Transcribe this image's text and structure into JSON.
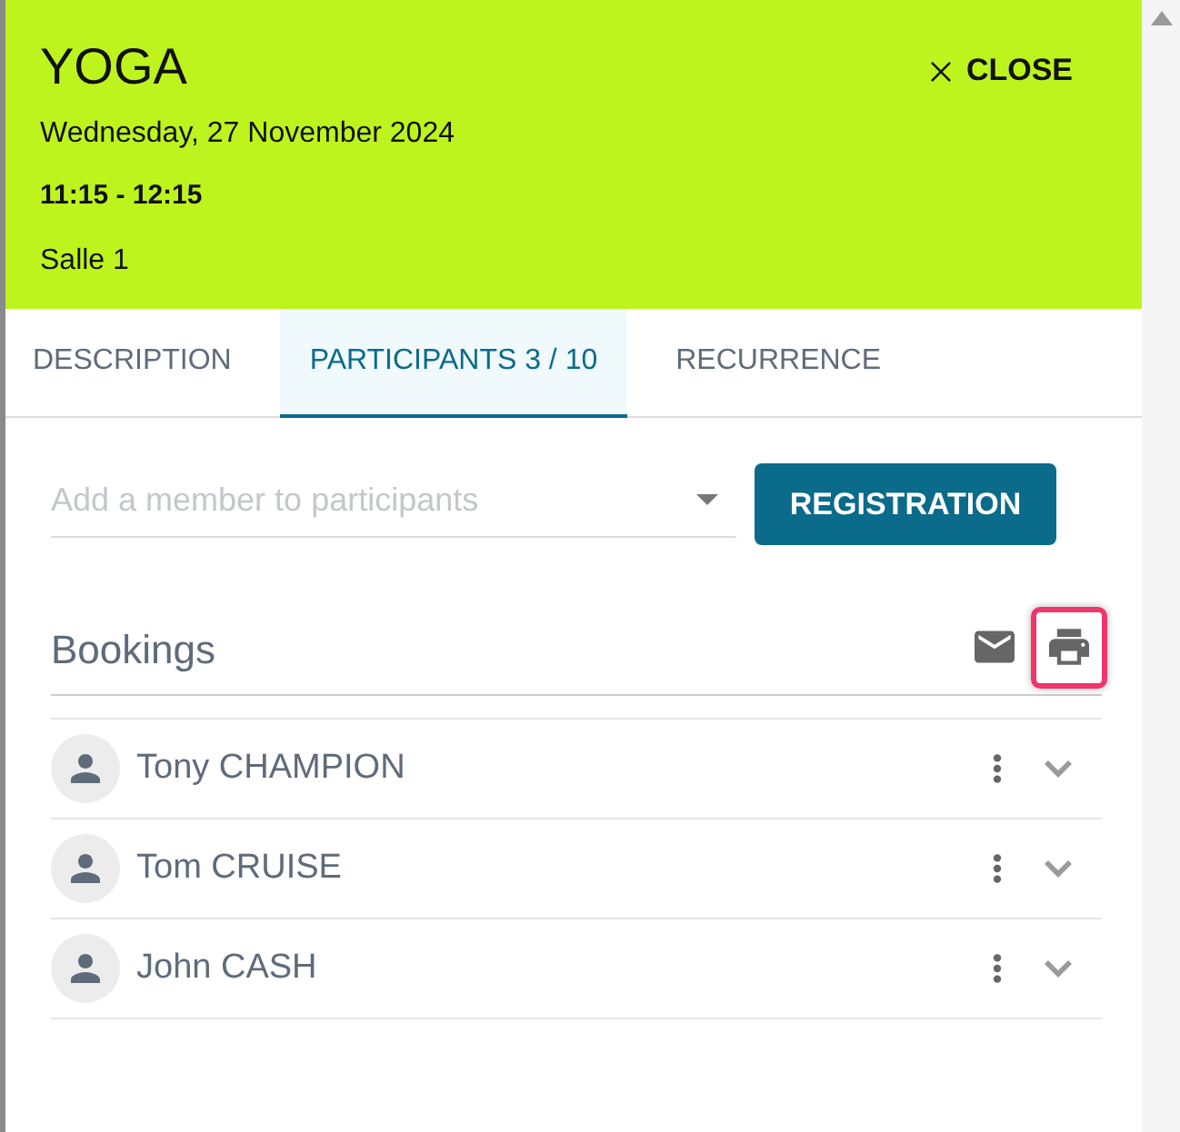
{
  "event": {
    "title": "YOGA",
    "date": "Wednesday, 27 November 2024",
    "time": "11:15 - 12:15",
    "room": "Salle 1"
  },
  "close_button": {
    "label": "CLOSE"
  },
  "tabs": [
    {
      "label": "DESCRIPTION",
      "selected": false
    },
    {
      "label": "PARTICIPANTS 3 / 10",
      "selected": true
    },
    {
      "label": "RECURRENCE",
      "selected": false
    }
  ],
  "member_field": {
    "placeholder": "Add a member to participants"
  },
  "registration_button": {
    "label": "REGISTRATION"
  },
  "bookings": {
    "title": "Bookings",
    "actions": [
      {
        "kind": "mail",
        "highlighted": false
      },
      {
        "kind": "print",
        "highlighted": true
      }
    ],
    "participants": [
      {
        "name": "Tony CHAMPION"
      },
      {
        "name": "Tom CRUISE"
      },
      {
        "name": "John CASH"
      }
    ]
  }
}
